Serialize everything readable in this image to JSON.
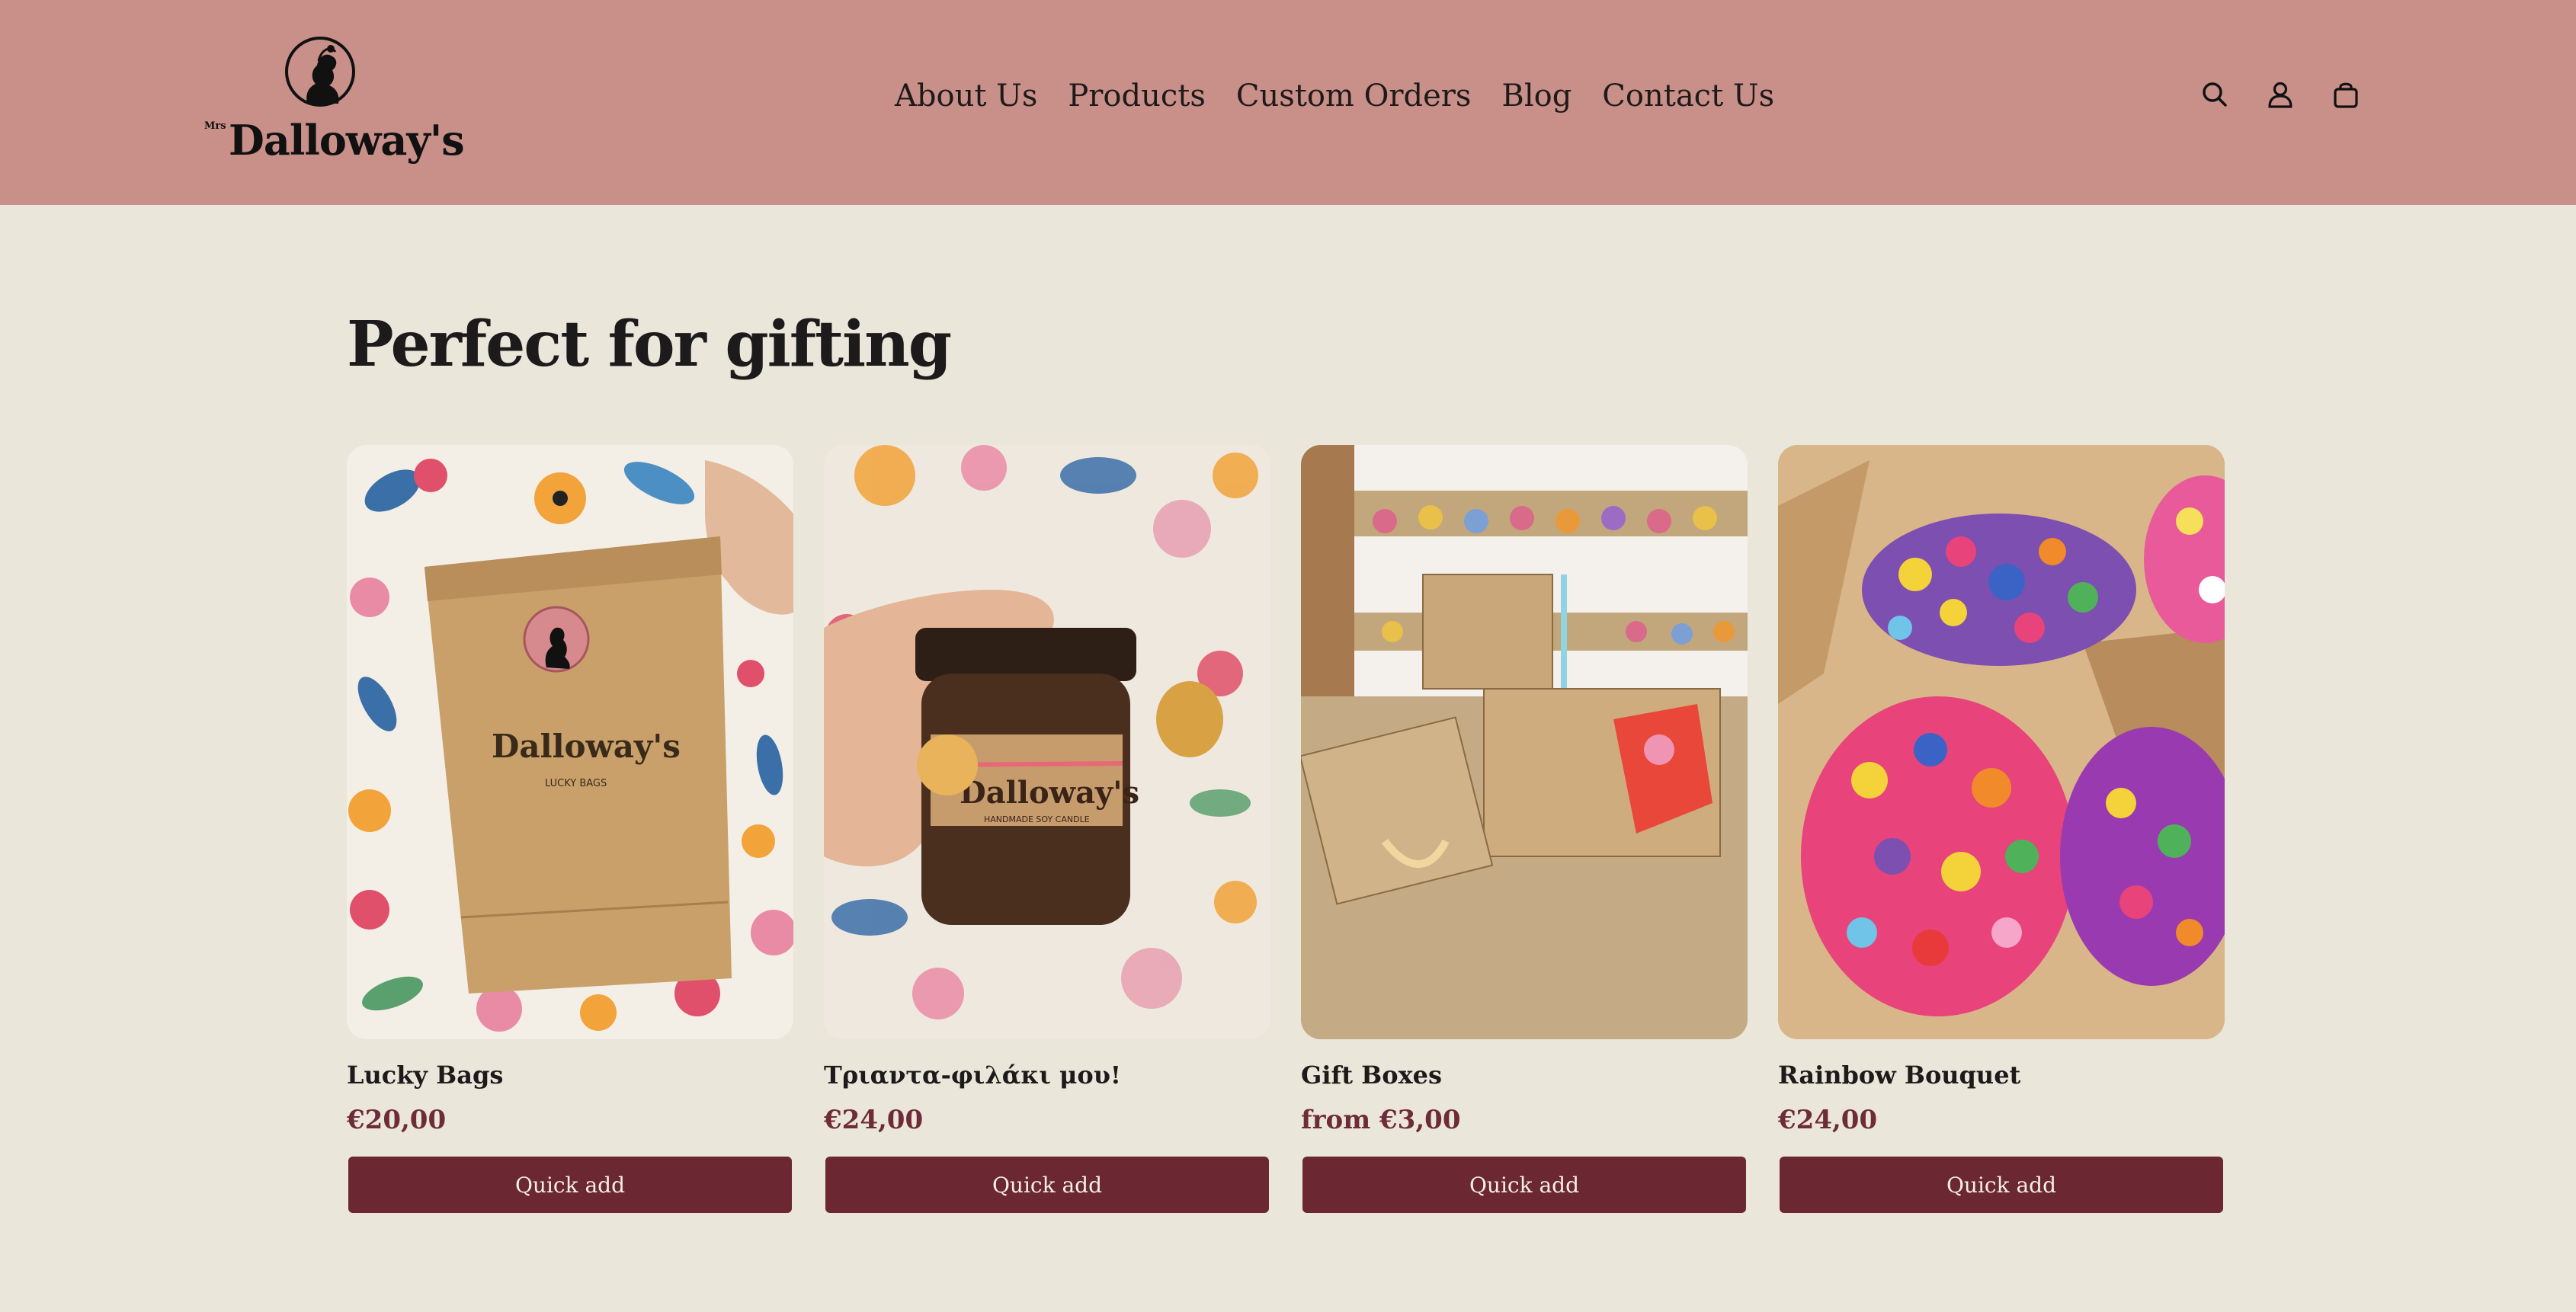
{
  "header": {
    "logo": {
      "prefix": "Mrs",
      "name": "Dalloway's"
    },
    "nav": [
      "About Us",
      "Products",
      "Custom Orders",
      "Blog",
      "Contact Us"
    ],
    "icons": [
      "search-icon",
      "account-icon",
      "cart-icon"
    ]
  },
  "section": {
    "title": "Perfect for gifting"
  },
  "products": [
    {
      "name": "Lucky Bags",
      "price": "€20,00",
      "button": "Quick add"
    },
    {
      "name": "Τριαντα-φιλάκι μου!",
      "price": "€24,00",
      "button": "Quick add"
    },
    {
      "name": "Gift Boxes",
      "price": "from €3,00",
      "button": "Quick add"
    },
    {
      "name": "Rainbow Bouquet",
      "price": "€24,00",
      "button": "Quick add"
    }
  ],
  "colors": {
    "header": "#c89089",
    "background": "#ebe6da",
    "button": "#6b2832",
    "price": "#6e2b38"
  }
}
